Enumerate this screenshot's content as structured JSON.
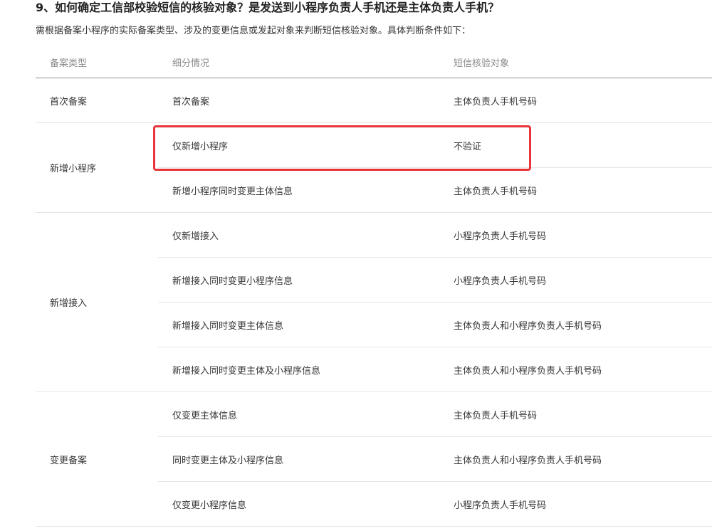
{
  "title": "9、如何确定工信部校验短信的核验对象？是发送到小程序负责人手机还是主体负责人手机？",
  "description": "需根据备案小程序的实际备案类型、涉及的变更信息或发起对象来判断短信核验对象。具体判断条件如下：",
  "table": {
    "headers": [
      "备案类型",
      "细分情况",
      "短信核验对象"
    ],
    "groups": [
      {
        "type": "首次备案",
        "rows": [
          {
            "sub": "首次备案",
            "target": "主体负责人手机号码"
          }
        ]
      },
      {
        "type": "新增小程序",
        "rows": [
          {
            "sub": "仅新增小程序",
            "target": "不验证"
          },
          {
            "sub": "新增小程序同时变更主体信息",
            "target": "主体负责人手机号码"
          }
        ]
      },
      {
        "type": "新增接入",
        "rows": [
          {
            "sub": "仅新增接入",
            "target": "小程序负责人手机号码"
          },
          {
            "sub": "新增接入同时变更小程序信息",
            "target": "小程序负责人手机号码"
          },
          {
            "sub": "新增接入同时变更主体信息",
            "target": "主体负责人和小程序负责人手机号码"
          },
          {
            "sub": "新增接入同时变更主体及小程序信息",
            "target": "主体负责人和小程序负责人手机号码"
          }
        ]
      },
      {
        "type": "变更备案",
        "rows": [
          {
            "sub": "仅变更主体信息",
            "target": "主体负责人手机号码"
          },
          {
            "sub": "同时变更主体及小程序信息",
            "target": "主体负责人和小程序负责人手机号码"
          },
          {
            "sub": "仅变更小程序信息",
            "target": "小程序负责人手机号码"
          }
        ]
      }
    ]
  },
  "highlight": {
    "group": 1,
    "row": 0,
    "color": "#e8343a"
  }
}
